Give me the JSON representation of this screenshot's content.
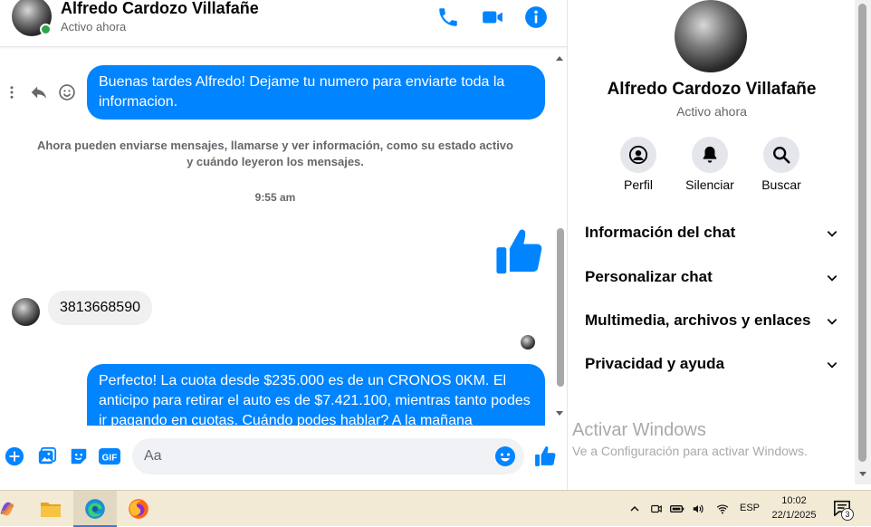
{
  "header": {
    "contact_name": "Alfredo Cardozo Villafañe",
    "status": "Activo ahora",
    "icons": [
      "phone-icon",
      "video-camera-icon",
      "info-icon"
    ]
  },
  "messages": [
    {
      "direction": "out",
      "text": "Buenas tardes Alfredo! Dejame tu numero para enviarte toda la informacion."
    },
    {
      "type": "system",
      "text": "Ahora pueden enviarse mensajes, llamarse y ver información, como su estado activo y cuándo leyeron los mensajes."
    },
    {
      "type": "timestamp",
      "text": "9:55 am"
    },
    {
      "direction": "out",
      "type": "like"
    },
    {
      "direction": "in",
      "text": "3813668590"
    },
    {
      "direction": "out",
      "text": "Perfecto! La cuota desde $235.000 es de un CRONOS 0KM. El anticipo para retirar el auto es de $7.421.100, mientras tanto podes ir pagando en cuotas. Cuándo podes hablar? A la mañana"
    }
  ],
  "composer": {
    "placeholder": "Aa",
    "icons": [
      "plus-icon",
      "gallery-icon",
      "sticker-icon",
      "gif-icon",
      "emoji-icon",
      "like-icon"
    ],
    "gif_label": "GIF"
  },
  "info_panel": {
    "name": "Alfredo Cardozo Villafañe",
    "status": "Activo ahora",
    "actions": [
      {
        "label": "Perfil",
        "icon": "profile-icon"
      },
      {
        "label": "Silenciar",
        "icon": "bell-icon"
      },
      {
        "label": "Buscar",
        "icon": "search-icon"
      }
    ],
    "sections": [
      "Información del chat",
      "Personalizar chat",
      "Multimedia, archivos y enlaces",
      "Privacidad y ayuda"
    ]
  },
  "watermark": {
    "title": "Activar Windows",
    "subtitle": "Ve a Configuración para activar Windows."
  },
  "taskbar": {
    "apps": [
      "copilot-icon",
      "file-explorer-icon",
      "edge-icon",
      "firefox-icon"
    ],
    "language": "ESP",
    "time": "10:02",
    "date": "22/1/2025",
    "notification_count": "3"
  },
  "colors": {
    "messenger_blue": "#0084ff",
    "online_green": "#31a24c",
    "taskbar_bg": "#f3ead6"
  }
}
